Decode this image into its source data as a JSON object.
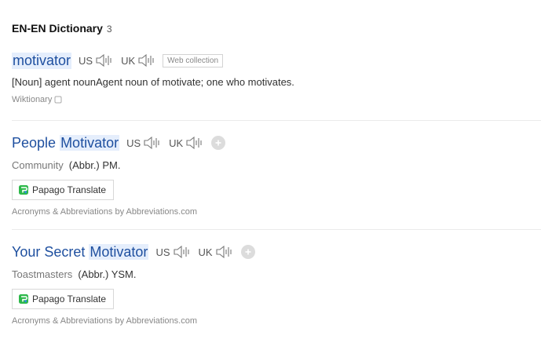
{
  "section": {
    "title": "EN-EN Dictionary",
    "count": "3"
  },
  "entries": [
    {
      "word": "motivator",
      "pron_us": "US",
      "pron_uk": "UK",
      "tag": "Web collection",
      "definition": "[Noun] agent nounAgent noun of motivate; one who motivates.",
      "source": "Wiktionary"
    },
    {
      "word_pre": "People ",
      "word_hl": "Motivator",
      "pron_us": "US",
      "pron_uk": "UK",
      "community": "Community",
      "abbr": "(Abbr.) PM.",
      "papago": "Papago Translate",
      "attribution": "Acronyms & Abbreviations by Abbreviations.com"
    },
    {
      "word_pre": "Your Secret ",
      "word_hl": "Motivator",
      "pron_us": "US",
      "pron_uk": "UK",
      "community": "Toastmasters",
      "abbr": "(Abbr.) YSM.",
      "papago": "Papago Translate",
      "attribution": "Acronyms & Abbreviations by Abbreviations.com"
    }
  ],
  "icons": {
    "speaker": "speaker-icon",
    "external": "external-link-icon",
    "add": "plus-icon",
    "papago": "papago-icon"
  },
  "colors": {
    "word": "#1e4f9f",
    "highlight": "#e5eefc",
    "papago_green": "#2db84a",
    "papago_blue": "#2a8ee8"
  }
}
